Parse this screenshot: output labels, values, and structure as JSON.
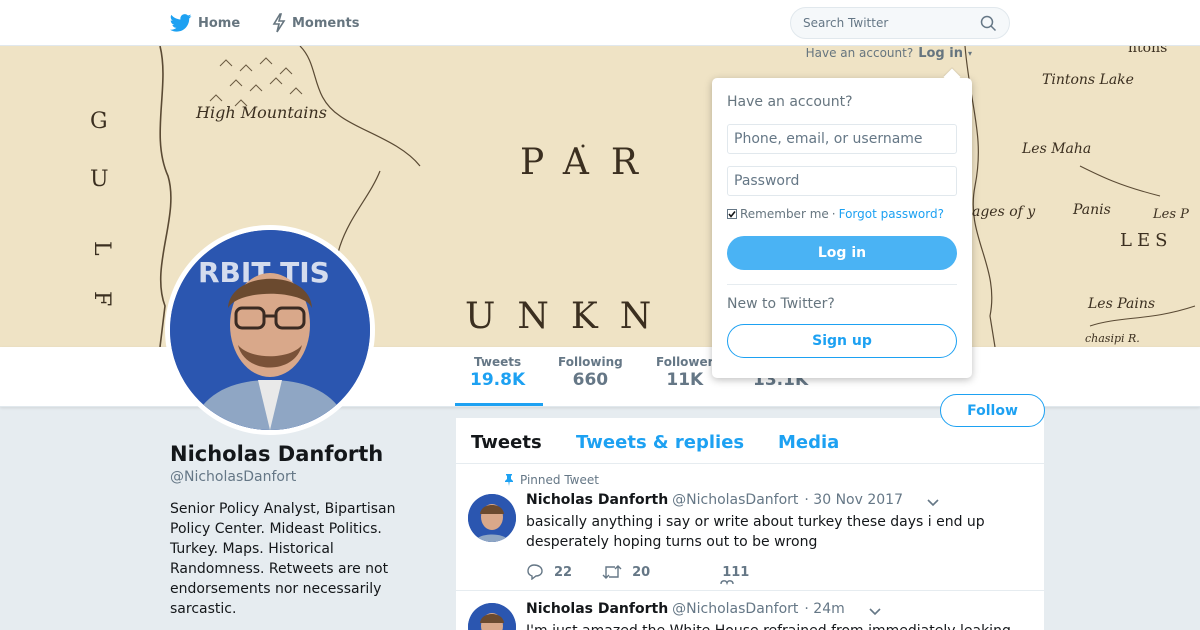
{
  "nav": {
    "home_label": "Home",
    "moments_label": "Moments",
    "search_placeholder": "Search Twitter",
    "login_prompt": "Have an account?",
    "login_link": "Log in"
  },
  "banner": {
    "labels": [
      "High Mountains",
      "PAR",
      "UNKN",
      "Tintons Lake",
      "Les Maha",
      "ages of y",
      "Panis",
      "Les P",
      "LES",
      "Les Pains",
      "chasipi R.",
      "G",
      "U",
      "L",
      "F",
      "ntons"
    ]
  },
  "profile": {
    "name": "Nicholas Danforth",
    "handle": "@NicholasDanfort",
    "bio": "Senior Policy Analyst, Bipartisan Policy Center. Mideast Politics. Turkey. Maps. Historical Randomness. Retweets are not endorsements nor necessarily sarcastic.",
    "avatar_text": "RBIT TIS"
  },
  "stats": [
    {
      "label": "Tweets",
      "value": "19.8K",
      "active": true
    },
    {
      "label": "Following",
      "value": "660",
      "active": false
    },
    {
      "label": "Follower",
      "value": "11K",
      "active": false
    },
    {
      "label": "",
      "value": "13.1K",
      "active": false
    }
  ],
  "follow_button": "Follow",
  "timeline": {
    "tabs": [
      "Tweets",
      "Tweets & replies",
      "Media"
    ],
    "tweets": [
      {
        "pinned_label": "Pinned Tweet",
        "name": "Nicholas Danforth",
        "handle": "@NicholasDanfort",
        "time": "· 30 Nov 2017",
        "text": "basically anything i say or write about turkey these days i end up desperately hoping turns out to be wrong",
        "replies": "22",
        "retweets": "20",
        "likes": "111"
      },
      {
        "name": "Nicholas Danforth",
        "handle": "@NicholasDanfort",
        "time": "· 24m",
        "text": "I'm just amazed the White House refrained from immediately leaking"
      }
    ]
  },
  "login_dropdown": {
    "title": "Have an account?",
    "username_placeholder": "Phone, email, or username",
    "password_placeholder": "Password",
    "remember_label": "Remember me",
    "separator": "·",
    "forgot_label": "Forgot password?",
    "login_button": "Log in",
    "new_label": "New to Twitter?",
    "signup_button": "Sign up"
  },
  "colors": {
    "accent": "#1da1f2",
    "login_button_bg": "#4ab3f4",
    "page_bg": "#e6ecf0",
    "banner_bg": "#ecdfbf"
  }
}
